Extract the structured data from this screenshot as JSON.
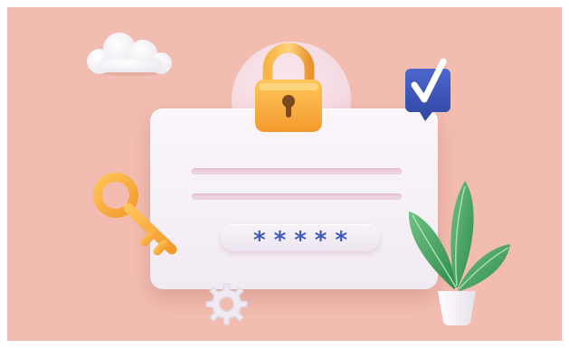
{
  "password": {
    "mask": "*****"
  },
  "colors": {
    "background": "#f2bdb0",
    "card": "#f6f0f6",
    "field_lines": "#edd3df",
    "lock_body": "#f5a93a",
    "lock_shackle": "#e9ddf0",
    "key": "#f6a83a",
    "badge": "#3b55b8",
    "checkmark": "#ffffff",
    "leaves": "#3f9a5c",
    "pot": "#ffffff",
    "asterisks": "#3f5bbd",
    "gear": "#ede8ef",
    "cloud": "#ffffff"
  },
  "icons": [
    "cloud-icon",
    "padlock-icon",
    "checkmark-badge-icon",
    "key-icon",
    "plant-icon",
    "gear-icon"
  ]
}
